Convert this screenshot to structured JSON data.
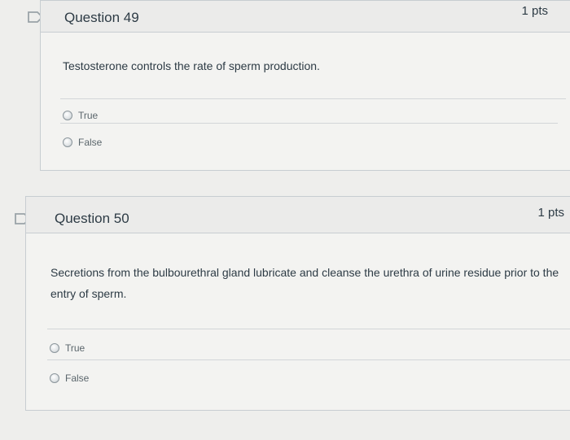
{
  "questions": [
    {
      "title": "Question 49",
      "points": "1 pts",
      "text": "Testosterone controls the rate of sperm production.",
      "answers": [
        "True",
        "False"
      ]
    },
    {
      "title": "Question 50",
      "points": "1 pts",
      "text": "Secretions from the bulbourethral gland lubricate and cleanse the urethra of urine residue prior to the entry of sperm.",
      "answers": [
        "True",
        "False"
      ]
    }
  ],
  "colors": {
    "background": "#eeeeec",
    "card": "#f3f3f1",
    "header": "#ebebea",
    "border": "#c7cdd1",
    "text": "#2d3b45"
  }
}
